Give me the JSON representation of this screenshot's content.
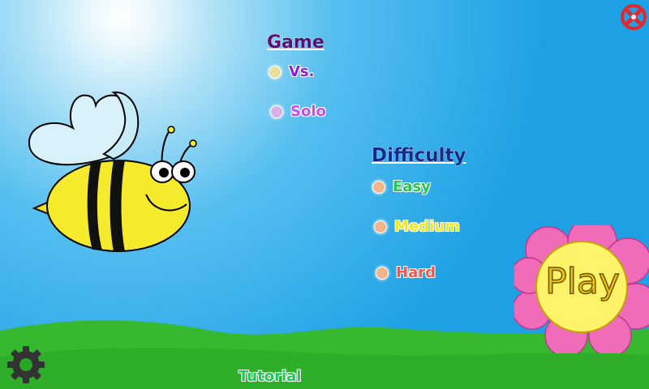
{
  "game_section": {
    "heading": "Game",
    "options": [
      {
        "label": "Vs.",
        "color": "#8f1fd6",
        "radio_color": "#e8e09a"
      },
      {
        "label": "Solo",
        "color": "#c24fe8",
        "radio_color": "#d7b0ea"
      }
    ]
  },
  "difficulty_section": {
    "heading": "Difficulty",
    "options": [
      {
        "label": "Easy",
        "color": "#2bc44c",
        "radio_color": "#f4b58c"
      },
      {
        "label": "Medium",
        "color": "#f1ea1b",
        "radio_color": "#f4b58c"
      },
      {
        "label": "Hard",
        "color": "#f0574e",
        "radio_color": "#f4b58c"
      }
    ]
  },
  "play_button": {
    "label": "Play",
    "petal_color": "#f06bb8",
    "center_color": "#fff36a"
  },
  "tutorial_link": {
    "label": "Tutorial"
  },
  "icons": {
    "close": "close-icon",
    "settings": "gear-icon",
    "mascot": "bee-mascot"
  },
  "colors": {
    "sky": "#2aa6e8",
    "grass": "#2bb52b",
    "close": "#e5262b",
    "gear": "#333333"
  }
}
